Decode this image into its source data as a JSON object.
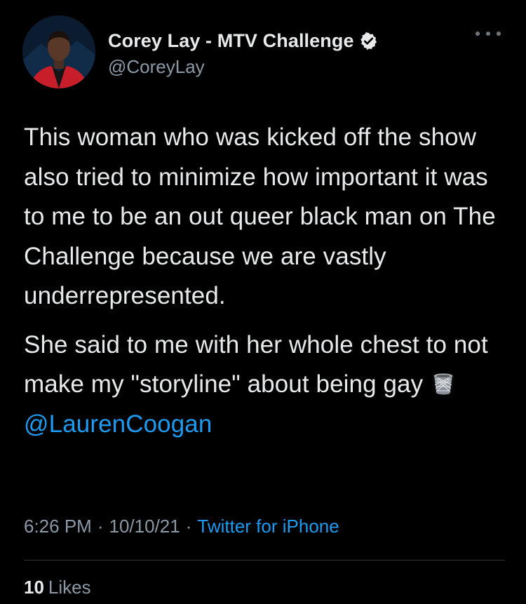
{
  "author": {
    "display_name": "Corey Lay - MTV Challenge",
    "handle": "@CoreyLay",
    "verified": true,
    "avatar_icon": "profile-photo-icon"
  },
  "tweet": {
    "paragraph1": "This woman who was kicked off the show also tried to minimize how important it was to me to be an out queer black man on The Challenge because we are vastly underrepresented.",
    "paragraph2_text": "She said to me with her whole chest to not make my \"storyline\" about being gay",
    "paragraph2_emoji": "wastebasket-icon",
    "mention": "@LaurenCoogan"
  },
  "meta": {
    "time": "6:26 PM",
    "separator": "·",
    "date": "10/10/21",
    "source": "Twitter for iPhone"
  },
  "stats": {
    "likes_count": "10",
    "likes_label": "Likes"
  },
  "colors": {
    "background": "#000000",
    "text": "#e7e9ea",
    "secondary": "#8b98a5",
    "accent": "#1d9bf0",
    "divider": "#2f3336"
  }
}
